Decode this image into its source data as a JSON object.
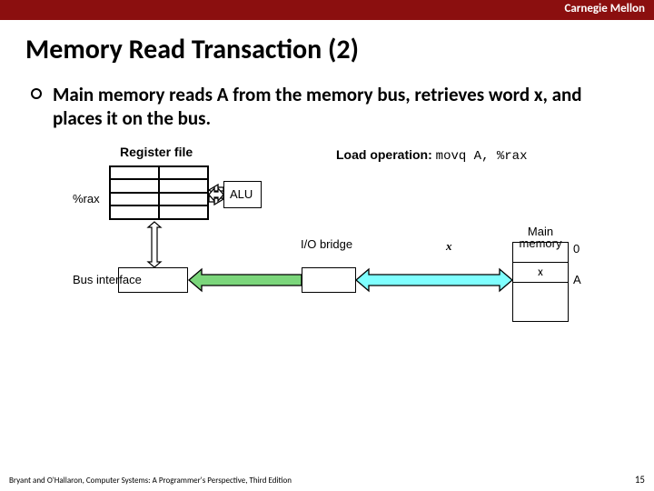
{
  "brand": "Carnegie Mellon",
  "title": "Memory Read Transaction (2)",
  "bullet": "Main memory reads A from the memory bus, retrieves word x, and places it on the bus.",
  "labels": {
    "regfile": "Register file",
    "rax": "%rax",
    "alu": "ALU",
    "iobridge": "I/O bridge",
    "businterface": "Bus interface",
    "mainmem": "Main memory",
    "zero": "0",
    "a": "A",
    "x_on_bus": "x",
    "mem_x": "x"
  },
  "loadop": {
    "prefix": "Load operation:",
    "code": "movq A, %rax"
  },
  "footer": {
    "cite": "Bryant and O'Hallaron, Computer Systems: A Programmer's Perspective, Third Edition",
    "page": "15"
  }
}
